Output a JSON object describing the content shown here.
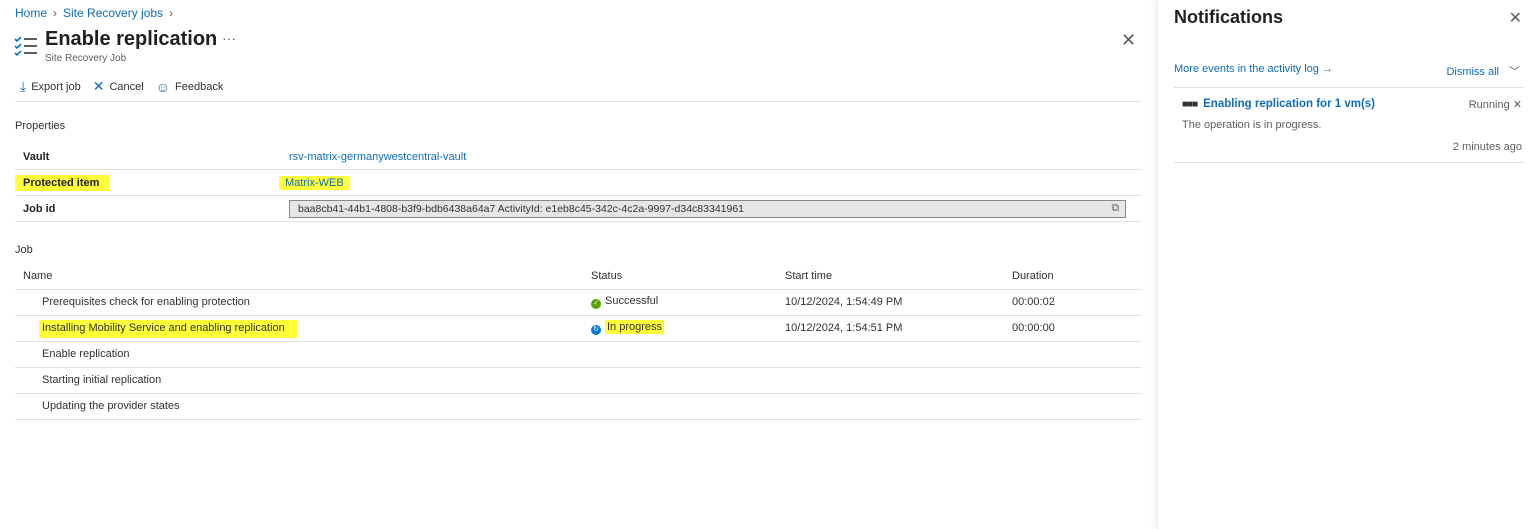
{
  "breadcrumb": [
    "Home",
    "Site Recovery jobs"
  ],
  "header": {
    "title": "Enable replication",
    "subtitle": "Site Recovery Job",
    "more": "···",
    "close": "✕"
  },
  "toolbar": {
    "export": "Export job",
    "cancel": "Cancel",
    "feedback": "Feedback"
  },
  "properties": {
    "heading": "Properties",
    "vault_label": "Vault",
    "vault_value": "rsv-matrix-germanywestcentral-vault",
    "item_label": "Protected item",
    "item_value": "Matrix-WEB",
    "jobid_label": "Job id",
    "jobid_value": "baa8cb41-44b1-4808-b3f9-bdb6438a64a7 ActivityId: e1eb8c45-342c-4c2a-9997-d34c83341961"
  },
  "job": {
    "heading": "Job",
    "columns": [
      "Name",
      "Status",
      "Start time",
      "Duration"
    ],
    "rows": [
      {
        "name": "Prerequisites check for enabling protection",
        "status": "Successful",
        "start": "10/12/2024, 1:54:49 PM",
        "duration": "00:00:02"
      },
      {
        "name": "Installing Mobility Service and enabling replication",
        "status": "In progress",
        "start": "10/12/2024, 1:54:51 PM",
        "duration": "00:00:00"
      },
      {
        "name": "Enable replication",
        "status": "",
        "start": "",
        "duration": ""
      },
      {
        "name": "Starting initial replication",
        "status": "",
        "start": "",
        "duration": ""
      },
      {
        "name": "Updating the provider states",
        "status": "",
        "start": "",
        "duration": ""
      }
    ]
  },
  "notifications": {
    "title": "Notifications",
    "more": "More events in the activity log →",
    "dismiss": "Dismiss all",
    "item": {
      "title": "Enabling replication for 1 vm(s)",
      "state": "Running",
      "body": "The operation is in progress.",
      "time": "2 minutes ago"
    }
  },
  "colors": {
    "accent": "#0f6cbd",
    "highlight": "#ffff3a",
    "success": "#57a300"
  }
}
